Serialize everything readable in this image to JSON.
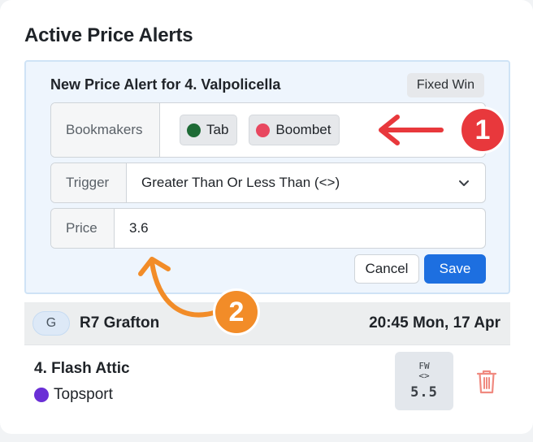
{
  "page": {
    "title": "Active Price Alerts"
  },
  "alert_form": {
    "heading": "New Price Alert for 4. Valpolicella",
    "type_badge": "Fixed Win",
    "bookmakers": {
      "label": "Bookmakers",
      "selected": [
        {
          "name": "Tab",
          "color": "#1e6b36"
        },
        {
          "name": "Boombet",
          "color": "#e8475f"
        }
      ]
    },
    "trigger": {
      "label": "Trigger",
      "value": "Greater Than Or Less Than (<>)"
    },
    "price": {
      "label": "Price",
      "value": "3.6"
    },
    "cancel_label": "Cancel",
    "save_label": "Save"
  },
  "race": {
    "code": "G",
    "name": "R7 Grafton",
    "time": "20:45 Mon, 17 Apr"
  },
  "alert_row": {
    "runner": "4. Flash Attic",
    "bookmaker": "Topsport",
    "bookmaker_color": "#6a2fd6",
    "price_type": "FW",
    "operator": "<>",
    "price": "5.5",
    "delete_icon": "trash-icon"
  },
  "annotations": [
    {
      "number": "1",
      "color": "#e8383c"
    },
    {
      "number": "2",
      "color": "#f28c28"
    }
  ]
}
